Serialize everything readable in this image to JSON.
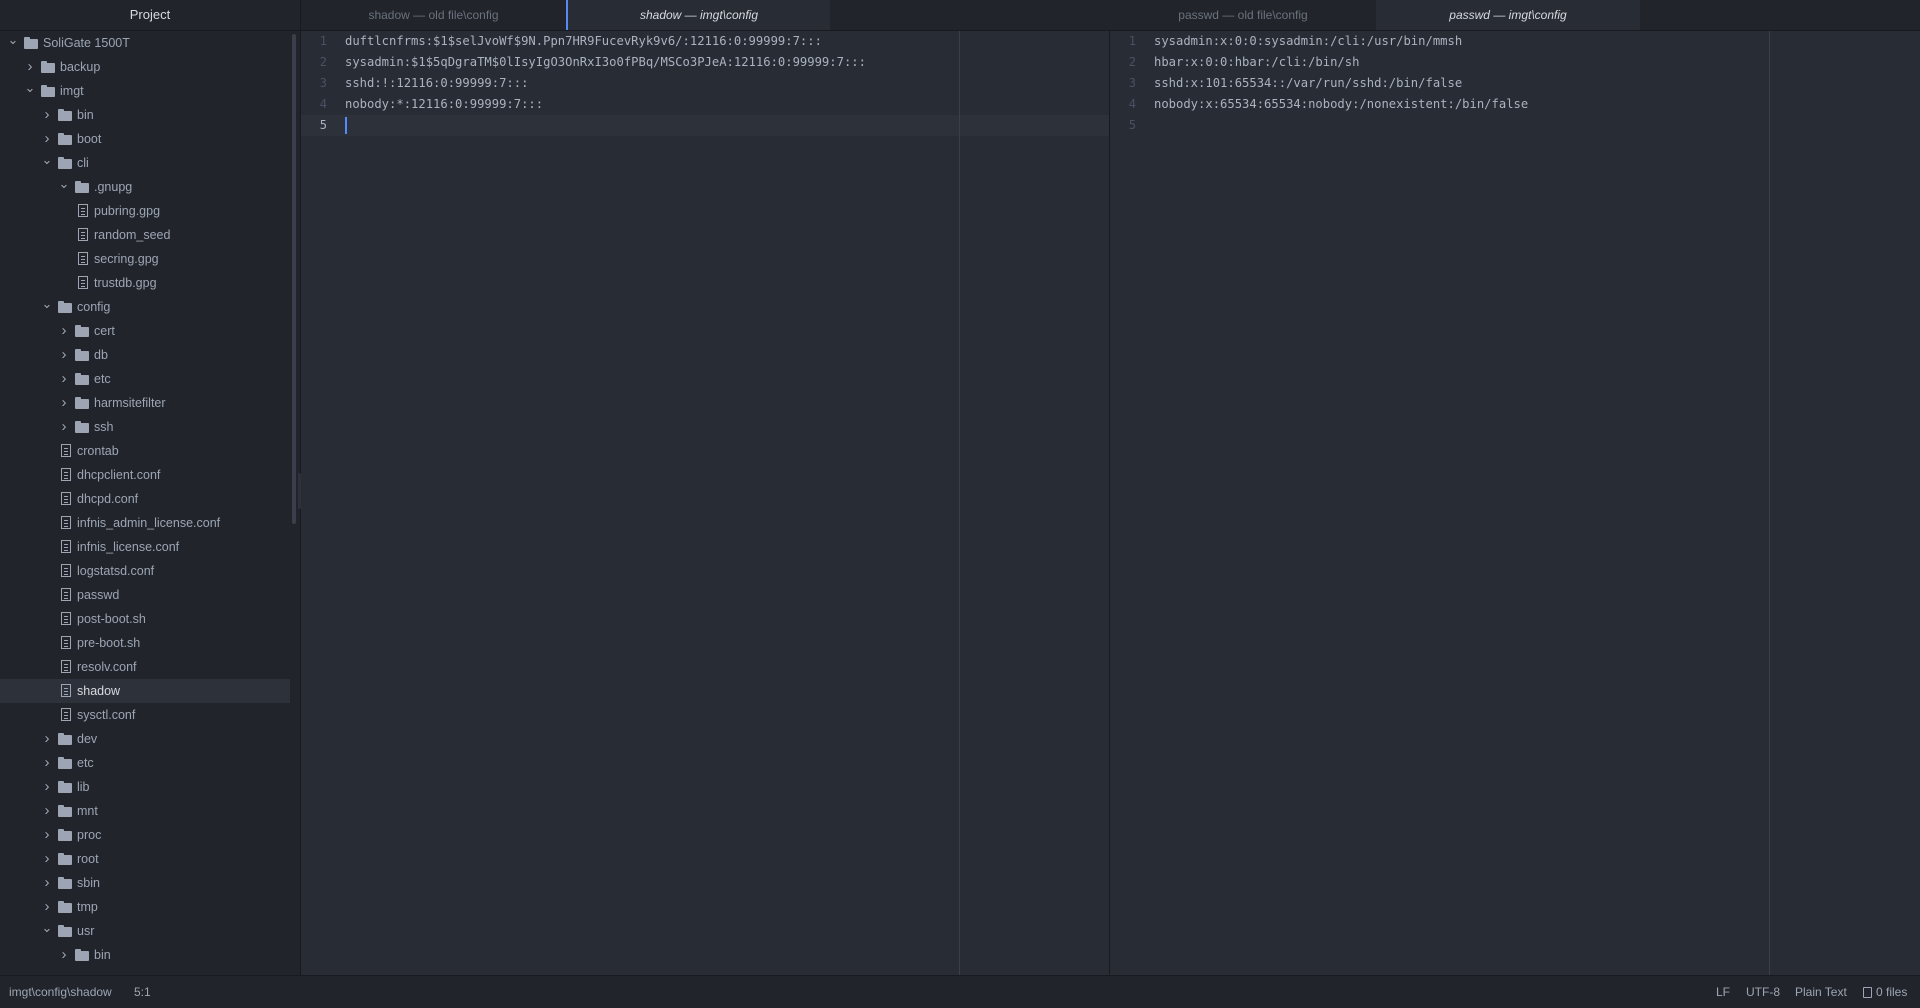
{
  "sidebar": {
    "title": "Project",
    "tree": [
      {
        "label": "SoliGate 1500T",
        "type": "folder",
        "depth": 0,
        "expanded": true
      },
      {
        "label": "backup",
        "type": "folder",
        "depth": 1,
        "expanded": false
      },
      {
        "label": "imgt",
        "type": "folder",
        "depth": 1,
        "expanded": true
      },
      {
        "label": "bin",
        "type": "folder",
        "depth": 2,
        "expanded": false
      },
      {
        "label": "boot",
        "type": "folder",
        "depth": 2,
        "expanded": false
      },
      {
        "label": "cli",
        "type": "folder",
        "depth": 2,
        "expanded": true
      },
      {
        "label": ".gnupg",
        "type": "folder",
        "depth": 3,
        "expanded": true
      },
      {
        "label": "pubring.gpg",
        "type": "file",
        "depth": 4
      },
      {
        "label": "random_seed",
        "type": "file",
        "depth": 4
      },
      {
        "label": "secring.gpg",
        "type": "file",
        "depth": 4
      },
      {
        "label": "trustdb.gpg",
        "type": "file",
        "depth": 4
      },
      {
        "label": "config",
        "type": "folder",
        "depth": 2,
        "expanded": true
      },
      {
        "label": "cert",
        "type": "folder",
        "depth": 3,
        "expanded": false
      },
      {
        "label": "db",
        "type": "folder",
        "depth": 3,
        "expanded": false
      },
      {
        "label": "etc",
        "type": "folder",
        "depth": 3,
        "expanded": false
      },
      {
        "label": "harmsitefilter",
        "type": "folder",
        "depth": 3,
        "expanded": false
      },
      {
        "label": "ssh",
        "type": "folder",
        "depth": 3,
        "expanded": false
      },
      {
        "label": "crontab",
        "type": "file",
        "depth": 3
      },
      {
        "label": "dhcpclient.conf",
        "type": "file",
        "depth": 3
      },
      {
        "label": "dhcpd.conf",
        "type": "file",
        "depth": 3
      },
      {
        "label": "infnis_admin_license.conf",
        "type": "file",
        "depth": 3
      },
      {
        "label": "infnis_license.conf",
        "type": "file",
        "depth": 3
      },
      {
        "label": "logstatsd.conf",
        "type": "file",
        "depth": 3
      },
      {
        "label": "passwd",
        "type": "file",
        "depth": 3
      },
      {
        "label": "post-boot.sh",
        "type": "file",
        "depth": 3
      },
      {
        "label": "pre-boot.sh",
        "type": "file",
        "depth": 3
      },
      {
        "label": "resolv.conf",
        "type": "file",
        "depth": 3
      },
      {
        "label": "shadow",
        "type": "file",
        "depth": 3,
        "selected": true
      },
      {
        "label": "sysctl.conf",
        "type": "file",
        "depth": 3
      },
      {
        "label": "dev",
        "type": "folder",
        "depth": 2,
        "expanded": false
      },
      {
        "label": "etc",
        "type": "folder",
        "depth": 2,
        "expanded": false
      },
      {
        "label": "lib",
        "type": "folder",
        "depth": 2,
        "expanded": false
      },
      {
        "label": "mnt",
        "type": "folder",
        "depth": 2,
        "expanded": false
      },
      {
        "label": "proc",
        "type": "folder",
        "depth": 2,
        "expanded": false
      },
      {
        "label": "root",
        "type": "folder",
        "depth": 2,
        "expanded": false
      },
      {
        "label": "sbin",
        "type": "folder",
        "depth": 2,
        "expanded": false
      },
      {
        "label": "tmp",
        "type": "folder",
        "depth": 2,
        "expanded": false
      },
      {
        "label": "usr",
        "type": "folder",
        "depth": 2,
        "expanded": true
      },
      {
        "label": "bin",
        "type": "folder",
        "depth": 3,
        "expanded": false
      }
    ]
  },
  "tabs": {
    "left": [
      {
        "label": "shadow — old file\\config",
        "active": false
      },
      {
        "label": "shadow — imgt\\config",
        "active": true
      }
    ],
    "right": [
      {
        "label": "passwd — old file\\config",
        "active": false
      },
      {
        "label": "passwd — imgt\\config",
        "active": true
      }
    ]
  },
  "editor_left": {
    "line_numbers": [
      "1",
      "2",
      "3",
      "4",
      "5"
    ],
    "lines": [
      "duftlcnfrms:$1$selJvoWf$9N.Ppn7HR9FucevRyk9v6/:12116:0:99999:7:::",
      "sysadmin:$1$5qDgraTM$0lIsyIgO3OnRxI3o0fPBq/MSCo3PJeA:12116:0:99999:7:::",
      "sshd:!:12116:0:99999:7:::",
      "nobody:*:12116:0:99999:7:::",
      ""
    ],
    "cursor_line": 5
  },
  "editor_right": {
    "line_numbers": [
      "1",
      "2",
      "3",
      "4",
      "5"
    ],
    "lines": [
      "sysadmin:x:0:0:sysadmin:/cli:/usr/bin/mmsh",
      "hbar:x:0:0:hbar:/cli:/bin/sh",
      "sshd:x:101:65534::/var/run/sshd:/bin/false",
      "nobody:x:65534:65534:nobody:/nonexistent:/bin/false",
      ""
    ]
  },
  "statusbar": {
    "path": "imgt\\config\\shadow",
    "cursor": "5:1",
    "line_ending": "LF",
    "encoding": "UTF-8",
    "grammar": "Plain Text",
    "files": "0 files"
  },
  "colors": {
    "background": "#282c34",
    "panel": "#21252b",
    "accent": "#568af2",
    "text": "#abb2bf"
  }
}
